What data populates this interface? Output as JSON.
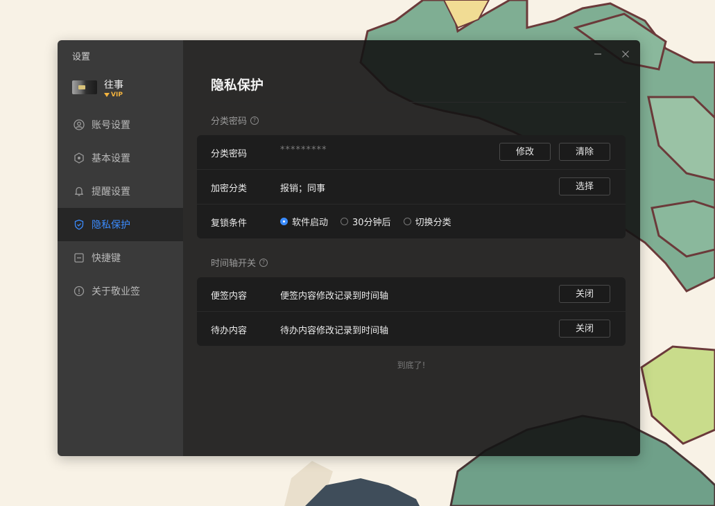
{
  "window": {
    "title": "设置"
  },
  "profile": {
    "name": "往事",
    "badge": "VIP"
  },
  "nav": {
    "items": [
      {
        "label": "账号设置",
        "icon": "user-circle-icon"
      },
      {
        "label": "基本设置",
        "icon": "gear-icon"
      },
      {
        "label": "提醒设置",
        "icon": "bell-icon"
      },
      {
        "label": "隐私保护",
        "icon": "shield-icon",
        "active": true
      },
      {
        "label": "快捷键",
        "icon": "keyboard-icon"
      },
      {
        "label": "关于敬业签",
        "icon": "info-icon"
      }
    ]
  },
  "page": {
    "title": "隐私保护"
  },
  "category_password": {
    "section_title": "分类密码",
    "rows": {
      "password": {
        "label": "分类密码",
        "value": "*********",
        "modify_label": "修改",
        "clear_label": "清除"
      },
      "encrypted": {
        "label": "加密分类",
        "value": "报销；同事",
        "select_label": "选择"
      },
      "relock": {
        "label": "复锁条件",
        "options": [
          "软件启动",
          "30分钟后",
          "切换分类"
        ],
        "selected": "软件启动"
      }
    }
  },
  "timeline": {
    "section_title": "时间轴开关",
    "rows": {
      "note": {
        "label": "便签内容",
        "desc": "便签内容修改记录到时间轴",
        "button_label": "关闭"
      },
      "todo": {
        "label": "待办内容",
        "desc": "待办内容修改记录到时间轴",
        "button_label": "关闭"
      }
    }
  },
  "footer": {
    "text": "到底了!"
  },
  "colors": {
    "accent": "#3b8cff",
    "vip": "#f3b33e",
    "sidebar": "#343434",
    "panel": "#141414"
  }
}
